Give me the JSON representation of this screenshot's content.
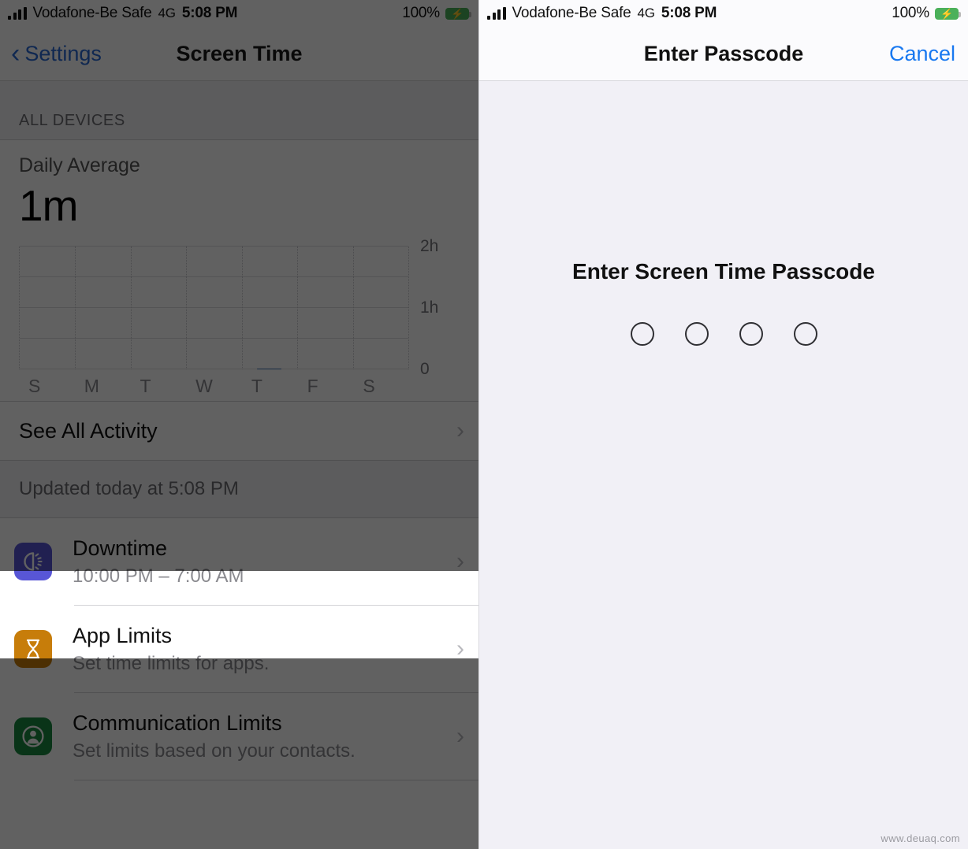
{
  "left": {
    "status_bar": {
      "signal_icon": "signal-bars-icon",
      "carrier": "Vodafone-Be Safe",
      "network": "4G",
      "time": "5:08 PM",
      "battery_percent": "100%",
      "battery_icon": "battery-charging-icon"
    },
    "nav": {
      "back_icon": "chevron-left-icon",
      "back_label": "Settings",
      "title": "Screen Time"
    },
    "section_header": "ALL DEVICES",
    "summary": {
      "label": "Daily Average",
      "value": "1m"
    },
    "see_all": {
      "label": "See All Activity",
      "chevron_icon": "chevron-right-icon"
    },
    "footnote": "Updated today at 5:08 PM",
    "items": [
      {
        "title": "Downtime",
        "subtitle": "10:00 PM – 7:00 AM",
        "icon": "downtime-moon-icon",
        "icon_color": "#5856d6",
        "highlighted": true
      },
      {
        "title": "App Limits",
        "subtitle": "Set time limits for apps.",
        "icon": "hourglass-icon",
        "icon_color": "#c77d0a",
        "highlighted": false
      },
      {
        "title": "Communication Limits",
        "subtitle": "Set limits based on your contacts.",
        "icon": "person-circle-icon",
        "icon_color": "#1a8a3f",
        "highlighted": false
      }
    ]
  },
  "right": {
    "status_bar": {
      "signal_icon": "signal-bars-icon",
      "carrier": "Vodafone-Be Safe",
      "network": "4G",
      "time": "5:08 PM",
      "battery_percent": "100%",
      "battery_icon": "battery-charging-icon"
    },
    "nav": {
      "title": "Enter Passcode",
      "cancel_label": "Cancel"
    },
    "prompt": "Enter Screen Time Passcode",
    "passcode_length": 4,
    "passcode_filled": 0
  },
  "watermark": "www.deuaq.com",
  "colors": {
    "ios_blue": "#007aff",
    "chart_bar": "#3a6fb0",
    "dim_overlay": "rgba(0,0,0,0.62)"
  },
  "chart_data": {
    "type": "bar",
    "title": "Daily Average",
    "categories": [
      "S",
      "M",
      "T",
      "W",
      "T",
      "F",
      "S"
    ],
    "values": [
      0,
      0,
      0,
      0,
      0.017,
      0,
      0
    ],
    "value_labels": [
      "0",
      "0",
      "0",
      "0",
      "1m",
      "0",
      "0"
    ],
    "ytick_labels": [
      "0",
      "1h",
      "2h"
    ],
    "ytick_values": [
      0,
      1,
      2
    ],
    "ylim": [
      0,
      2
    ],
    "xlabel": "",
    "ylabel": "",
    "grid": true,
    "legend": false,
    "series_color": "#3a6fb0"
  }
}
